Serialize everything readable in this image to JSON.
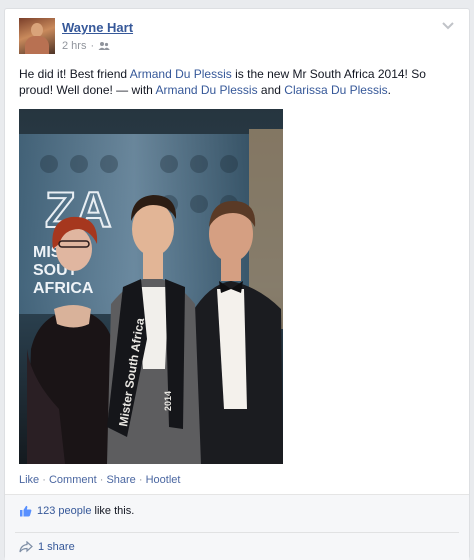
{
  "post": {
    "author": "Wayne Hart",
    "time": "2 hrs",
    "audience_icon": "friends-icon",
    "text_start": "He did it! Best friend ",
    "mention1": "Armand Du Plessis",
    "text_mid": " is the new Mr South Africa 2014! So proud! Well done! — with ",
    "mention2": "Armand Du Plessis",
    "text_and": " and ",
    "mention3": "Clarissa Du Plessis",
    "text_end": ".",
    "photo": {
      "backdrop_logo": "ZA",
      "backdrop_text1": "MIST",
      "backdrop_text2": "SOUT",
      "backdrop_text3": "AFRICA",
      "sash_text": "Mister South Africa",
      "sash_year": "2014"
    }
  },
  "actions": {
    "like": "Like",
    "comment": "Comment",
    "share": "Share",
    "hootlet": "Hootlet",
    "separator": " · "
  },
  "footer": {
    "likes_count": "123 people",
    "likes_suffix": " like this.",
    "shares": "1 share"
  },
  "colors": {
    "link": "#365899",
    "meta": "#90949c"
  }
}
